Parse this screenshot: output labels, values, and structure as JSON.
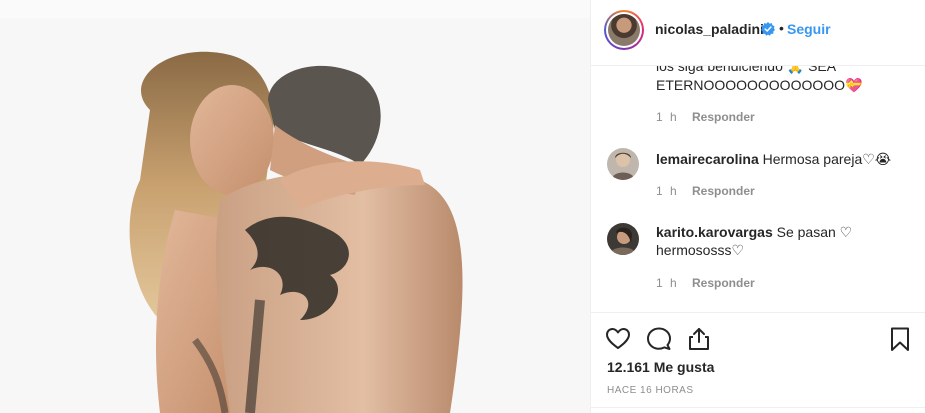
{
  "post": {
    "username": "nicolas_paladini",
    "separator": "•",
    "follow_label": "Seguir",
    "photo_alt": "post-photo"
  },
  "comments": {
    "partial_line_1": "los siga bendiciendo 🙏 SEA",
    "partial_line_2": "ETERNOOOOOOOOOOOOO💝",
    "partial_time": "1 h",
    "reply_label": "Responder",
    "items": [
      {
        "user": "lemairecarolina",
        "text": "Hermosa pareja♡😭",
        "time": "1 h",
        "reply": "Responder"
      },
      {
        "user": "karito.karovargas",
        "text_line_1": "Se pasan ♡",
        "text_line_2": "hermososss♡",
        "time": "1 h",
        "reply": "Responder"
      }
    ]
  },
  "footer": {
    "likes": "12.161 Me gusta",
    "time_ago": "HACE 16 HORAS"
  },
  "icons": {
    "like": "heart-outline-icon",
    "comment": "comment-bubble-icon",
    "share": "share-upload-icon",
    "save": "bookmark-icon",
    "verified": "verified-badge-icon"
  },
  "colors": {
    "link_blue": "#3897f0",
    "verified_blue": "#3897f0",
    "muted": "#8e8e8e",
    "text": "#262626",
    "border": "#efefef"
  }
}
